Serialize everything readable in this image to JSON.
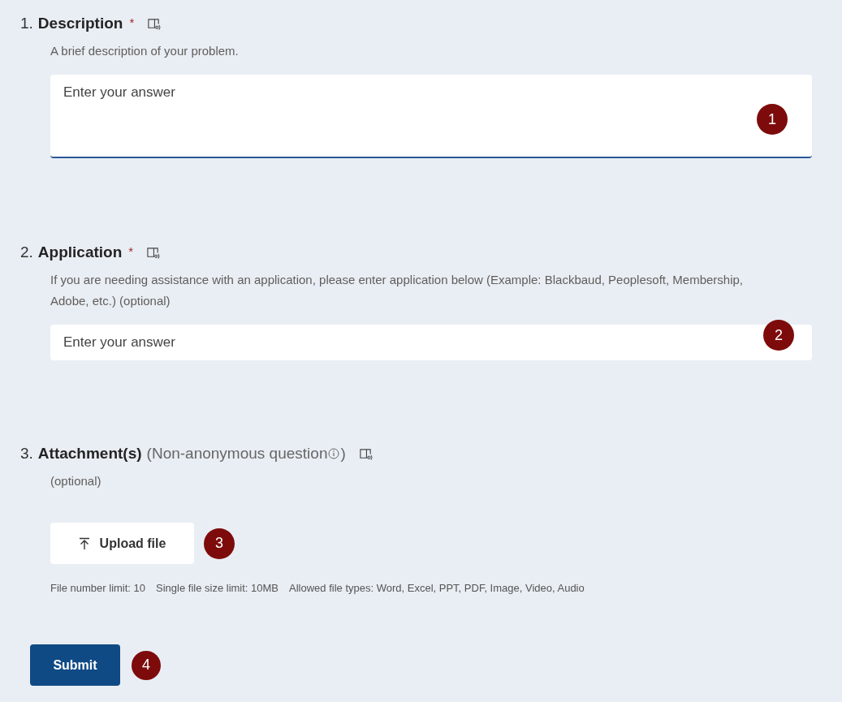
{
  "questions": [
    {
      "kind": "long",
      "number": "1.",
      "title": "Description",
      "required_mark": "*",
      "description": "A brief description of your problem.",
      "placeholder": "Enter your answer",
      "badge": "1"
    },
    {
      "kind": "short",
      "number": "2.",
      "title": "Application",
      "required_mark": "*",
      "description": "If you are needing assistance with an application, please enter application below (Example: Blackbaud, Peoplesoft, Membership, Adobe, etc.) (optional)",
      "placeholder": "Enter your answer",
      "badge": "2"
    },
    {
      "kind": "upload",
      "number": "3.",
      "title": "Attachment(s)",
      "note": "(Non-anonymous question",
      "note_end": ")",
      "description": "(optional)",
      "button": "Upload file",
      "badge": "3",
      "limits": [
        "File number limit: 10",
        "Single file size limit: 10MB",
        "Allowed file types: Word, Excel, PPT, PDF, Image, Video, Audio"
      ]
    }
  ],
  "submit": {
    "label": "Submit",
    "badge": "4"
  }
}
